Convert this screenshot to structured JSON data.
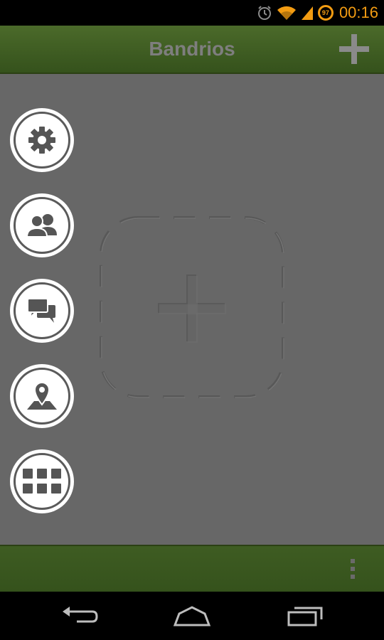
{
  "status_bar": {
    "time": "00:16",
    "battery_level": "97",
    "icons": [
      "alarm-icon",
      "wifi-icon",
      "signal-icon",
      "battery-icon"
    ],
    "accent_color": "#f39c12"
  },
  "action_bar": {
    "title": "Bandrios",
    "add_icon": "plus-icon",
    "color": "#3f5e22"
  },
  "sidebar": {
    "items": [
      {
        "name": "settings",
        "icon": "gear-icon"
      },
      {
        "name": "contacts",
        "icon": "people-icon"
      },
      {
        "name": "messages",
        "icon": "chat-icon"
      },
      {
        "name": "map",
        "icon": "map-pin-icon"
      },
      {
        "name": "apps",
        "icon": "grid-icon"
      }
    ]
  },
  "main": {
    "placeholder_icon": "dashed-plus-icon",
    "background": "#676767"
  },
  "bottom_bar": {
    "overflow_icon": "overflow-menu-icon"
  },
  "nav_bar": {
    "items": [
      "back-icon",
      "home-icon",
      "recents-icon"
    ]
  }
}
